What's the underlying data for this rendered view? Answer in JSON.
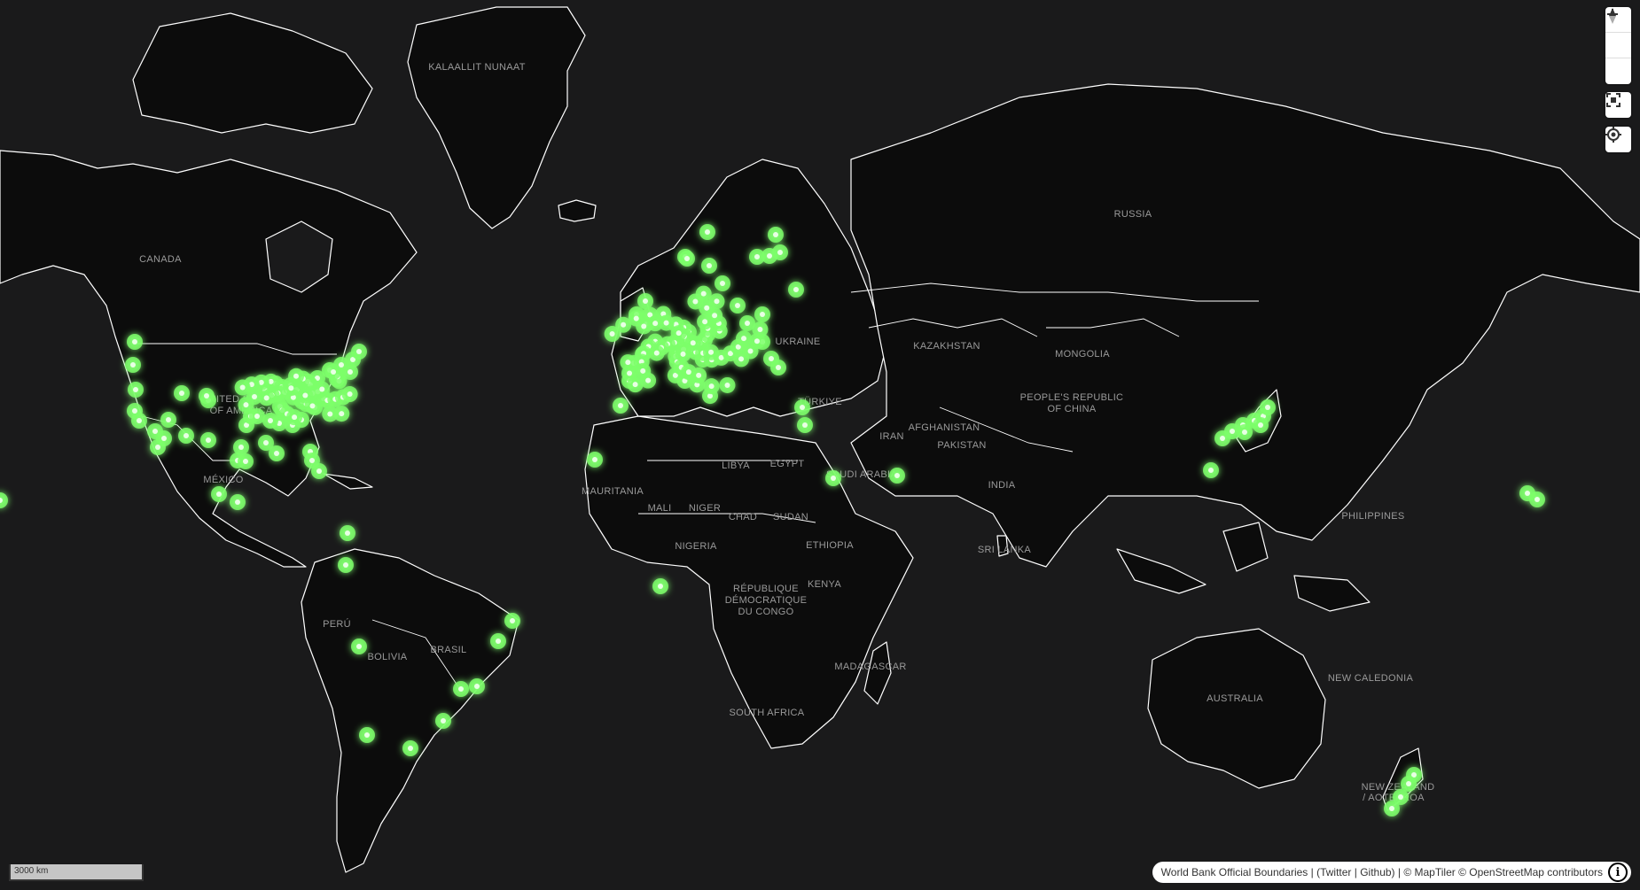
{
  "map": {
    "country_labels": [
      {
        "id": "greenland",
        "text": "KALAALLIT NUNAAT"
      },
      {
        "id": "canada",
        "text": "CANADA"
      },
      {
        "id": "russia",
        "text": "RUSSIA"
      },
      {
        "id": "kazakhstan",
        "text": "KAZAKHSTAN"
      },
      {
        "id": "mongolia",
        "text": "MONGOLIA"
      },
      {
        "id": "china-1",
        "text": "PEOPLE'S REPUBLIC"
      },
      {
        "id": "china-2",
        "text": "OF CHINA"
      },
      {
        "id": "iran",
        "text": "IRAN"
      },
      {
        "id": "india",
        "text": "INDIA"
      },
      {
        "id": "libya",
        "text": "LIBYA"
      },
      {
        "id": "egypt",
        "text": "EGYPT"
      },
      {
        "id": "mali",
        "text": "MALI"
      },
      {
        "id": "niger",
        "text": "NIGER"
      },
      {
        "id": "chad",
        "text": "CHAD"
      },
      {
        "id": "sudan",
        "text": "SUDAN"
      },
      {
        "id": "mauritania",
        "text": "MAURITANIA"
      },
      {
        "id": "nigeria",
        "text": "NIGERIA"
      },
      {
        "id": "mexico",
        "text": "MÉXICO"
      },
      {
        "id": "brasil",
        "text": "BRASIL"
      },
      {
        "id": "bolivia",
        "text": "BOLIVIA"
      },
      {
        "id": "peru",
        "text": "PERÚ"
      },
      {
        "id": "australia",
        "text": "AUSTRALIA"
      },
      {
        "id": "philippines",
        "text": "PHILIPPINES"
      },
      {
        "id": "new-caledonia",
        "text": "NEW CALEDONIA"
      },
      {
        "id": "new-zealand-1",
        "text": "NEW ZEALAND"
      },
      {
        "id": "new-zealand-2",
        "text": "/ AOTEAROA"
      },
      {
        "id": "madagascar",
        "text": "MADAGASCAR"
      },
      {
        "id": "kenya",
        "text": "KENYA"
      },
      {
        "id": "ethiopia",
        "text": "ETHIOPIA"
      },
      {
        "id": "drc-1",
        "text": "RÉPUBLIQUE"
      },
      {
        "id": "drc-2",
        "text": "DÉMOCRATIQUE"
      },
      {
        "id": "drc-3",
        "text": "DU CONGO"
      },
      {
        "id": "saudi",
        "text": "SAUDI ARABIA"
      },
      {
        "id": "afghanistan",
        "text": "AFGHANISTAN"
      },
      {
        "id": "pakistan",
        "text": "PAKISTAN"
      },
      {
        "id": "turkiye",
        "text": "TÜRKIYE"
      },
      {
        "id": "ukraine",
        "text": "UKRAINE"
      },
      {
        "id": "usa-1",
        "text": "UNITED STATES"
      },
      {
        "id": "usa-2",
        "text": "OF AMERICA"
      },
      {
        "id": "sri-lanka",
        "text": "SRI LANKA"
      },
      {
        "id": "south-africa",
        "text": "SOUTH AFRICA"
      }
    ],
    "heat_color": "#7dff6a",
    "background_color": "#1a1a1b",
    "land_color": "#0c0c0c",
    "border_color": "#ffffff"
  },
  "controls": {
    "zoom_in": "+",
    "zoom_out": "−",
    "icons": [
      "plus-icon",
      "minus-icon",
      "compass-icon",
      "fullscreen-icon",
      "geolocate-icon"
    ]
  },
  "scale": {
    "label": "3000 km"
  },
  "attribution": {
    "text": "World Bank Official Boundaries | (Twitter | Github) | © MapTiler © OpenStreetMap contributors",
    "info": "i"
  }
}
